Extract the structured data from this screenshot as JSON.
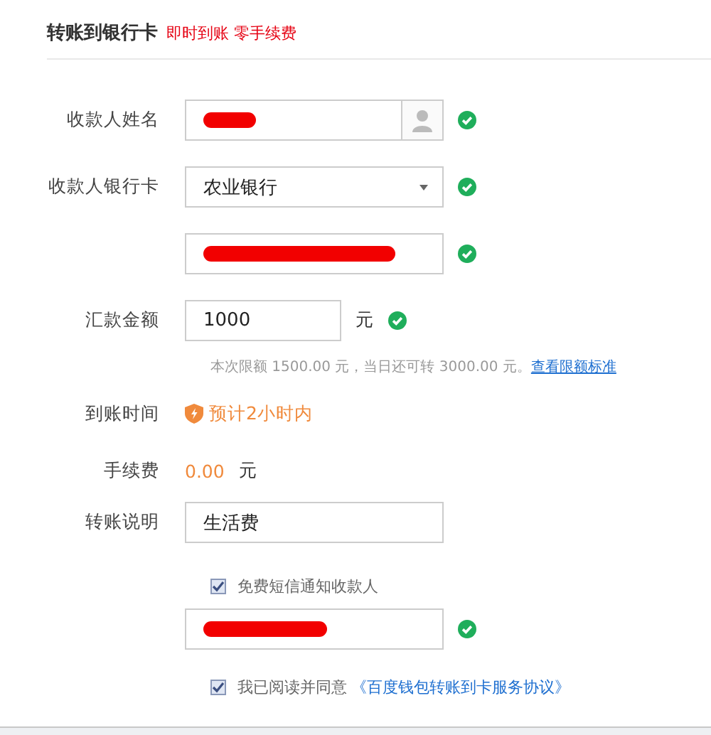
{
  "header": {
    "title": "转账到银行卡",
    "tagline": "即时到账 零手续费"
  },
  "form": [
    {
      "kind": "input",
      "label": "收款人姓名",
      "redacted": true,
      "valid": true,
      "contact_button": true
    },
    {
      "kind": "select",
      "label": "收款人银行卡",
      "value": "农业银行",
      "valid": true
    },
    {
      "kind": "input",
      "redacted": true,
      "valid": true
    },
    {
      "kind": "amount",
      "label": "汇款金额",
      "value": "1000",
      "unit": "元",
      "valid": true,
      "hint": "本次限额 1500.00 元，当日还可转 3000.00 元。",
      "hint_link": "查看限额标准"
    },
    {
      "kind": "info",
      "label": "到账时间",
      "value": "预计2小时内",
      "shield": true
    },
    {
      "kind": "fee",
      "label": "手续费",
      "value": "0.00",
      "unit": "元"
    },
    {
      "kind": "input",
      "label": "转账说明",
      "value": "生活费"
    },
    {
      "kind": "checkbox",
      "text": "免费短信通知收款人",
      "checked": true
    },
    {
      "kind": "input",
      "redacted": true,
      "valid": true
    },
    {
      "kind": "agree",
      "text": "我已阅读并同意",
      "link": "《百度钱包转账到卡服务协议》",
      "checked": true
    }
  ]
}
